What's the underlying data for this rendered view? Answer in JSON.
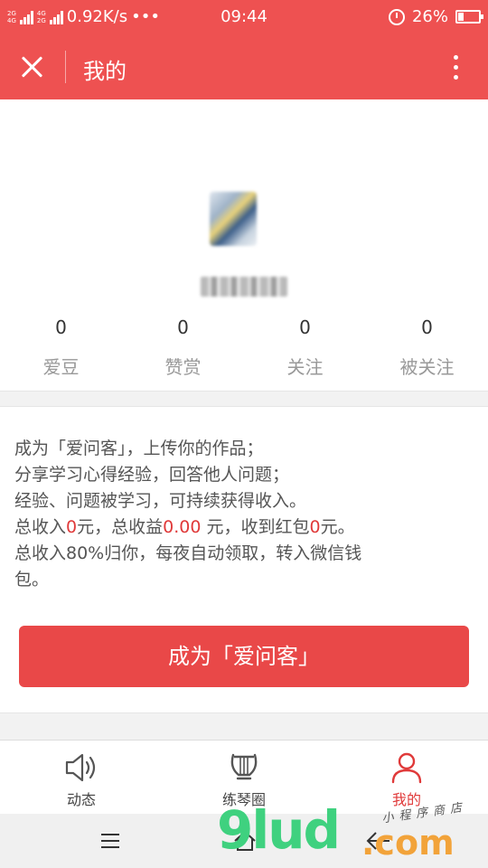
{
  "status_bar": {
    "net_labels": [
      "2G",
      "4G",
      "4G",
      "2G"
    ],
    "speed": "0.92K/s",
    "dots": "•••",
    "time": "09:44",
    "battery": "26%",
    "battery_level": 0.26
  },
  "nav": {
    "title": "我的"
  },
  "profile": {
    "stats": [
      {
        "value": "0",
        "label": "爱豆"
      },
      {
        "value": "0",
        "label": "赞赏"
      },
      {
        "value": "0",
        "label": "关注"
      },
      {
        "value": "0",
        "label": "被关注"
      }
    ]
  },
  "info": {
    "line1": "成为「爱问客」，上传你的作品；",
    "line2": "分享学习心得经验，回答他人问题；",
    "line3": "经验、问题被学习，可持续获得收入。",
    "line4_a": "总收入",
    "total_income": "0",
    "line4_b": "元，总收益",
    "total_earnings": "0.00",
    "line4_c": " 元，收到红包",
    "red_packets": "0",
    "line4_d": "元。",
    "line5": "总收入80%归你，每夜自动领取，转入微信钱",
    "line6": "包。",
    "button_label": "成为「爱问客」"
  },
  "tabs": [
    {
      "label": "动态",
      "icon": "speaker-icon"
    },
    {
      "label": "练琴圈",
      "icon": "lyre-icon"
    },
    {
      "label": "我的",
      "icon": "person-icon",
      "active": true
    }
  ],
  "watermark": {
    "brand": "9lud",
    "domain": ".com",
    "tagline": "小程序商店"
  },
  "colors": {
    "brand_red": "#ee5151",
    "button_red": "#e94848",
    "highlight_red": "#e03a3a"
  }
}
